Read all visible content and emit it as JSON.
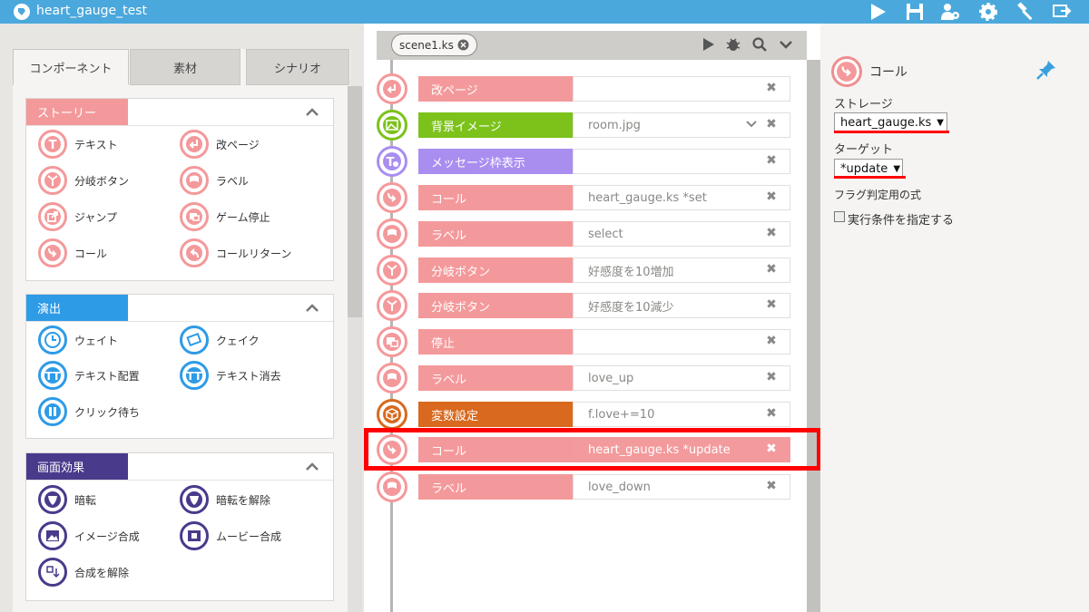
{
  "app": {
    "title": "heart_gauge_test"
  },
  "topbar_icons": [
    "play-icon",
    "save-icon",
    "users-gear-icon",
    "gear-icon",
    "hammer-icon",
    "exit-icon"
  ],
  "left": {
    "tabs": [
      "コンポーネント",
      "素材",
      "シナリオ"
    ],
    "sections": [
      {
        "title": "ストーリー",
        "color": "#f4999b",
        "items": [
          "テキスト",
          "改ページ",
          "分岐ボタン",
          "ラベル",
          "ジャンプ",
          "ゲーム停止",
          "コール",
          "コールリターン"
        ]
      },
      {
        "title": "演出",
        "color": "#2e9be6",
        "items": [
          "ウェイト",
          "クェイク",
          "テキスト配置",
          "テキスト消去",
          "クリック待ち"
        ]
      },
      {
        "title": "画面効果",
        "color": "#4a3a8c",
        "items": [
          "暗転",
          "暗転を解除",
          "イメージ合成",
          "ムービー合成",
          "合成を解除"
        ]
      }
    ]
  },
  "center": {
    "scene_tab": "scene1.ks",
    "rows": [
      {
        "label": "改ページ",
        "value": "",
        "color": "#f4999b"
      },
      {
        "label": "背景イメージ",
        "value": "room.jpg",
        "color": "#7cc21a"
      },
      {
        "label": "メッセージ枠表示",
        "value": "",
        "color": "#a98ef0"
      },
      {
        "label": "コール",
        "value": "heart_gauge.ks *set",
        "color": "#f4999b"
      },
      {
        "label": "ラベル",
        "value": "select",
        "color": "#f4999b"
      },
      {
        "label": "分岐ボタン",
        "value": "好感度を10増加",
        "color": "#f4999b"
      },
      {
        "label": "分岐ボタン",
        "value": "好感度を10減少",
        "color": "#f4999b"
      },
      {
        "label": "停止",
        "value": "",
        "color": "#f4999b"
      },
      {
        "label": "ラベル",
        "value": "love_up",
        "color": "#f4999b"
      },
      {
        "label": "変数設定",
        "value": "f.love+=10",
        "color": "#d8691e"
      },
      {
        "label": "コール",
        "value": "heart_gauge.ks *update",
        "color": "#f4999b"
      },
      {
        "label": "ラベル",
        "value": "love_down",
        "color": "#f4999b"
      }
    ]
  },
  "right": {
    "title": "コール",
    "storage_label": "ストレージ",
    "storage_value": "heart_gauge.ks",
    "target_label": "ターゲット",
    "target_value": "*update",
    "flag_label": "フラグ判定用の式",
    "checkbox_label": "実行条件を指定する"
  }
}
